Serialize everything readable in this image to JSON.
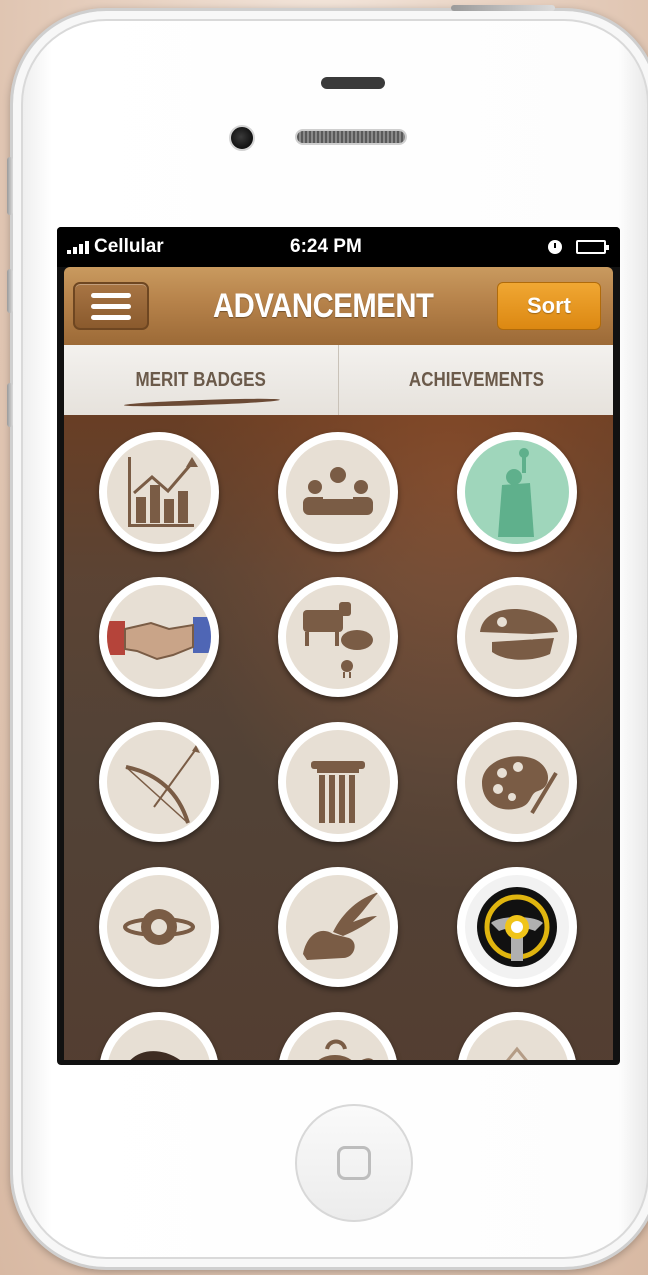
{
  "status_bar": {
    "carrier": "Cellular",
    "time": "6:24 PM"
  },
  "navbar": {
    "title": "ADVANCEMENT",
    "sort_label": "Sort"
  },
  "tabs": [
    {
      "label": "MERIT BADGES",
      "active": true
    },
    {
      "label": "ACHIEVEMENTS",
      "active": false
    }
  ],
  "badges": [
    {
      "icon": "bar-chart-icon"
    },
    {
      "icon": "meeting-people-icon"
    },
    {
      "icon": "statue-of-liberty-icon"
    },
    {
      "icon": "handshake-icon"
    },
    {
      "icon": "farm-animals-icon"
    },
    {
      "icon": "dinosaur-skull-icon"
    },
    {
      "icon": "bow-and-arrow-icon"
    },
    {
      "icon": "column-icon"
    },
    {
      "icon": "paint-palette-icon"
    },
    {
      "icon": "planet-icon"
    },
    {
      "icon": "winged-shoe-icon"
    },
    {
      "icon": "steering-wheel-icon"
    },
    {
      "icon": "rock-icon"
    },
    {
      "icon": "kettle-icon"
    },
    {
      "icon": "tent-icon"
    }
  ],
  "colors": {
    "nav_brown": "#b6824a",
    "sort_orange": "#e8961f",
    "tab_text": "#6b5a4a",
    "badge_bg": "#e7dfd4",
    "icon_brown": "#7a5c45"
  }
}
